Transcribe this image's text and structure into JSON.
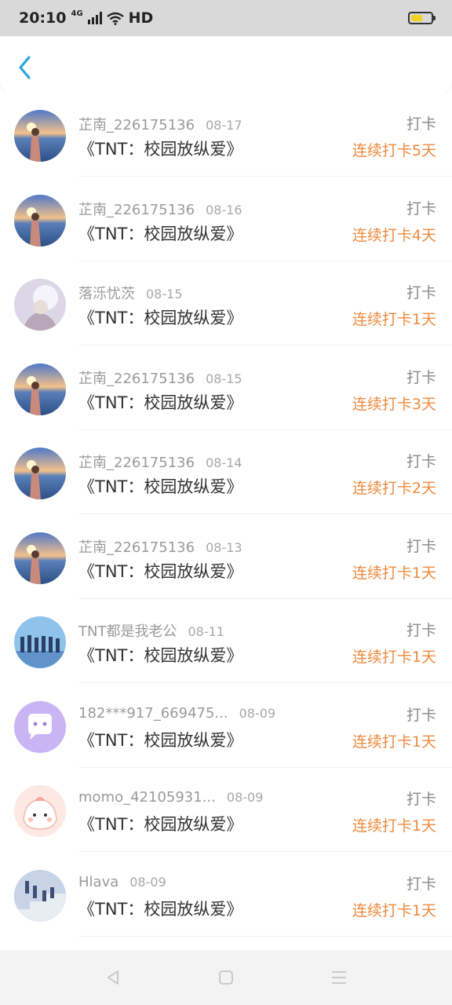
{
  "status_bar": {
    "time": "20:10",
    "network": "4G",
    "hd": "HD"
  },
  "checkins": [
    {
      "user": "芷南_226175136",
      "date": "08-17",
      "title": "《TNT：校园放纵爱》",
      "tag": "打卡",
      "streak": "连续打卡5天",
      "avatar": "sunset"
    },
    {
      "user": "芷南_226175136",
      "date": "08-16",
      "title": "《TNT：校园放纵爱》",
      "tag": "打卡",
      "streak": "连续打卡4天",
      "avatar": "sunset"
    },
    {
      "user": "落泺忧茨",
      "date": "08-15",
      "title": "《TNT：校园放纵爱》",
      "tag": "打卡",
      "streak": "连续打卡1天",
      "avatar": "light"
    },
    {
      "user": "芷南_226175136",
      "date": "08-15",
      "title": "《TNT：校园放纵爱》",
      "tag": "打卡",
      "streak": "连续打卡3天",
      "avatar": "sunset"
    },
    {
      "user": "芷南_226175136",
      "date": "08-14",
      "title": "《TNT：校园放纵爱》",
      "tag": "打卡",
      "streak": "连续打卡2天",
      "avatar": "sunset"
    },
    {
      "user": "芷南_226175136",
      "date": "08-13",
      "title": "《TNT：校园放纵爱》",
      "tag": "打卡",
      "streak": "连续打卡1天",
      "avatar": "sunset"
    },
    {
      "user": "TNT都是我老公",
      "date": "08-11",
      "title": "《TNT：校园放纵爱》",
      "tag": "打卡",
      "streak": "连续打卡1天",
      "avatar": "group"
    },
    {
      "user": "182***917_669475...",
      "date": "08-09",
      "title": "《TNT：校园放纵爱》",
      "tag": "打卡",
      "streak": "连续打卡1天",
      "avatar": "chat"
    },
    {
      "user": "momo_42105931...",
      "date": "08-09",
      "title": "《TNT：校园放纵爱》",
      "tag": "打卡",
      "streak": "连续打卡1天",
      "avatar": "cartoon"
    },
    {
      "user": "Hlava",
      "date": "08-09",
      "title": "《TNT：校园放纵爱》",
      "tag": "打卡",
      "streak": "连续打卡1天",
      "avatar": "stairs"
    }
  ],
  "colors": {
    "accent_back": "#2aa3e0",
    "streak": "#ef8a3d"
  }
}
